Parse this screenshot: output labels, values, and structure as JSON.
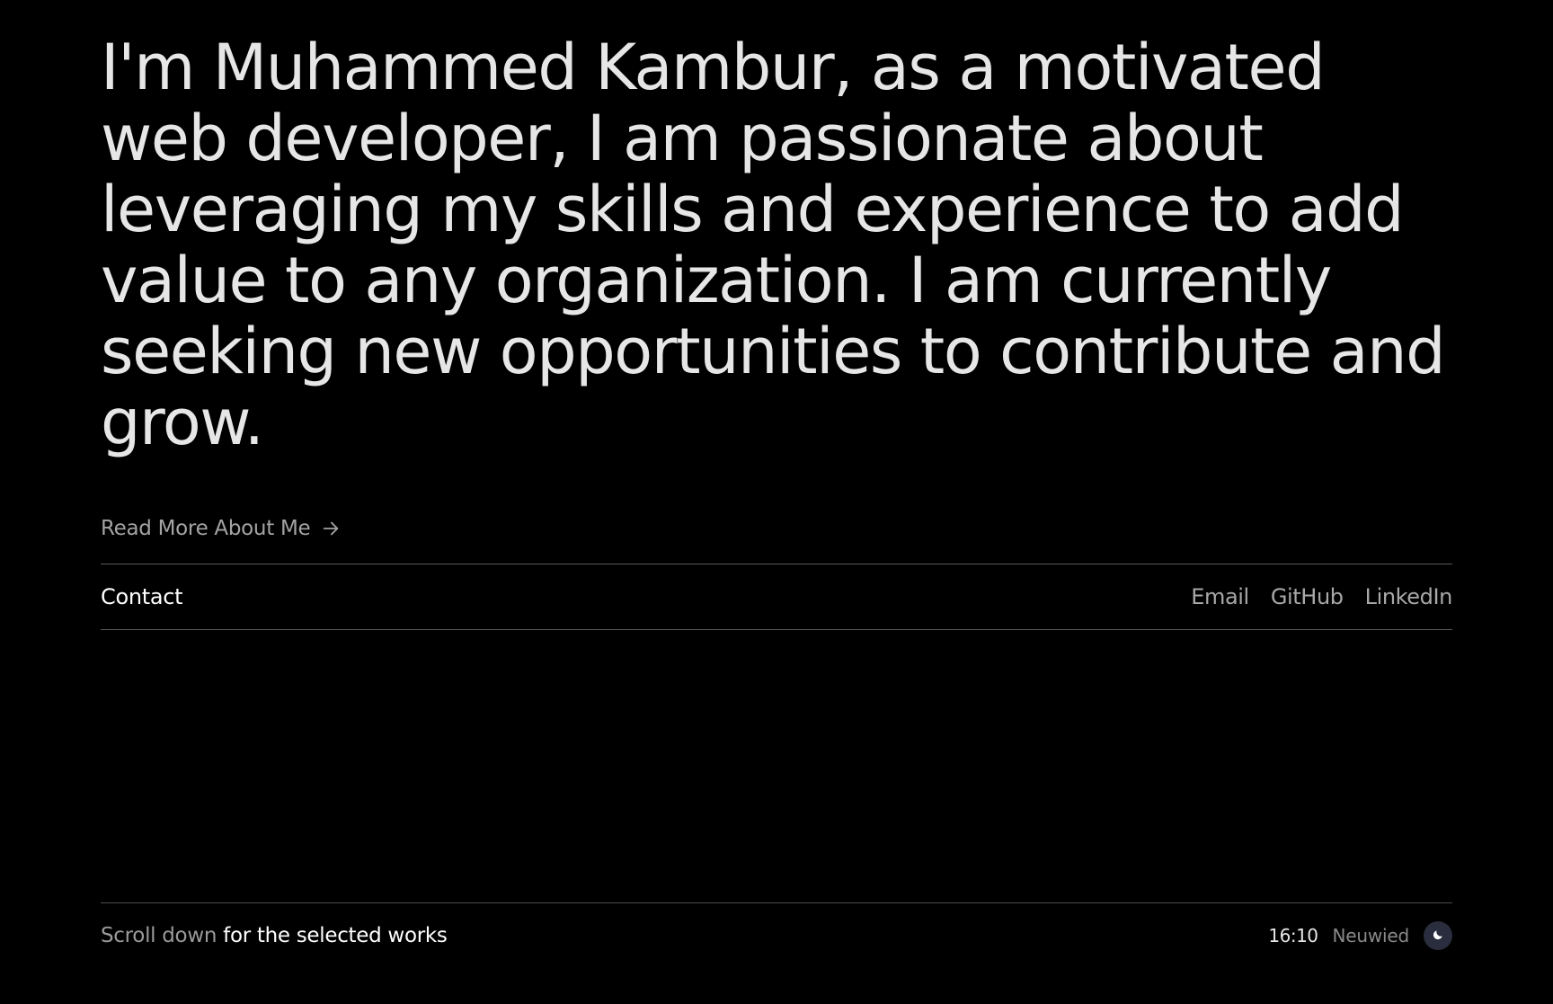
{
  "hero": {
    "text": "I'm Muhammed Kambur, as a motivated web developer, I am passionate about leveraging my skills and experience to add value to any organization. I am currently seeking new opportunities to contribute and grow."
  },
  "read_more": {
    "label": "Read More About Me",
    "icon": "arrow-right-icon"
  },
  "contact": {
    "label": "Contact",
    "links": [
      "Email",
      "GitHub",
      "LinkedIn"
    ]
  },
  "footer": {
    "scroll_dim": "Scroll down",
    "scroll_bright": "for the selected works",
    "time": "16:10",
    "city": "Neuwied",
    "theme_icon": "moon-icon"
  },
  "colors": {
    "background": "#000000",
    "text": "#e6e6e6",
    "muted": "#a3a3a3",
    "divider": "#5a5a5a",
    "toggle_bg": "#2a2d3d"
  }
}
